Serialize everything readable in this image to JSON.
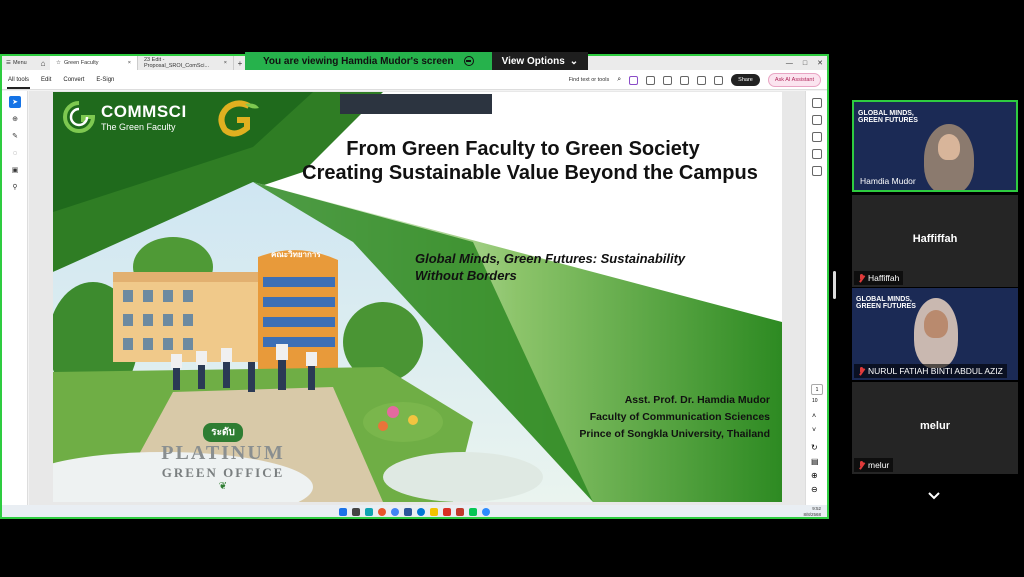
{
  "banner": {
    "viewing": "You are viewing  Hamdia Mudor's screen",
    "view_options": "View Options"
  },
  "acrobat": {
    "menu": "Menu",
    "tabs": [
      "Green Faculty",
      "23 Edit -Proposal_SROI_ComSci..."
    ],
    "toolbar": [
      "All tools",
      "Edit",
      "Convert",
      "E-Sign"
    ],
    "find": "Find text or tools",
    "share": "Share",
    "ai": "Ask AI Assistant",
    "page_current": "1",
    "page_total": "10"
  },
  "slide": {
    "logo_name": "COMMSCI",
    "logo_tagline": "The Green Faculty",
    "title_line1": "From Green Faculty to Green Society",
    "title_line2": "Creating Sustainable Value Beyond the Campus",
    "subtitle_line1": "Global Minds, Green Futures: Sustainability",
    "subtitle_line2": "Without Borders",
    "author": "Asst. Prof. Dr. Hamdia Mudor",
    "affiliation1": "Faculty of Communication Sciences",
    "affiliation2": "Prince of Songkla University, Thailand",
    "building_sign": "คณะวิทยาการ",
    "badge_thai": "ระดับ",
    "platinum": "PLATINUM",
    "green_office": "GREEN OFFICE"
  },
  "taskbar": {
    "time": "9:52",
    "date": "8/8/2568"
  },
  "participants": [
    {
      "name": "Hamdia Mudor",
      "video": true,
      "conf_text": [
        "GLOBAL MINDS,",
        "GREEN FUTURES"
      ]
    },
    {
      "name": "Haffiffah",
      "video": false
    },
    {
      "name": "NURUL FATIAH BINTI ABDUL AZIZ",
      "video": true,
      "conf_text": [
        "GLOBAL MINDS,",
        "GREEN FUTURES"
      ]
    },
    {
      "name": "melur",
      "video": false
    }
  ],
  "colors": {
    "active_border": "#2ecc40",
    "banner_green": "#26b24c",
    "slide_green": "#2e8b2e"
  }
}
